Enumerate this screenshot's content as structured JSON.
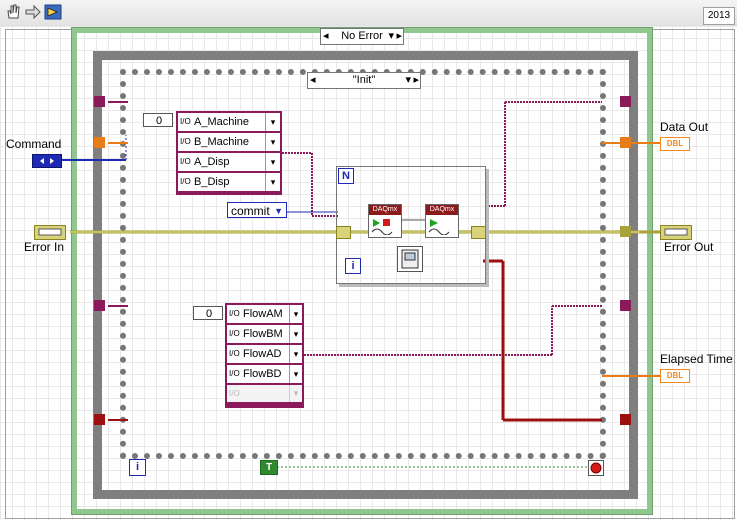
{
  "app": {
    "version": "2013"
  },
  "toolbar": {
    "tools": [
      "hand-tool",
      "arrow-tool",
      "run-icon"
    ]
  },
  "event_case": {
    "selector": "No Error"
  },
  "state_case": {
    "selector": "\"Init\""
  },
  "labels": {
    "command": "Command",
    "error_in": "Error In",
    "data_out": "Data Out",
    "error_out": "Error Out",
    "elapsed_time": "Elapsed Time"
  },
  "ring_a": {
    "index": "0",
    "items": [
      "A_Machine",
      "B_Machine",
      "A_Disp",
      "B_Disp"
    ]
  },
  "ring_b": {
    "index": "0",
    "items": [
      "FlowAM",
      "FlowBM",
      "FlowAD",
      "FlowBD",
      ""
    ]
  },
  "commit_enum": {
    "value": "commit"
  },
  "for_loop": {
    "count_terminal": "N",
    "iteration_terminal": "i"
  },
  "while_loop": {
    "iteration_terminal": "i",
    "true_constant": "T"
  },
  "daqmx": {
    "node1": "DAQmx",
    "node2": "DAQmx"
  },
  "indicators": {
    "dbl": "DBL"
  },
  "colors": {
    "case_green": "#8fc78f",
    "while_gray": "#808080",
    "cluster_wire": "#8b1a5a",
    "error_wire": "#a8a23a",
    "enum_wire": "#1e2ab4",
    "orange_wire": "#e87d18",
    "dbl_wire": "#f08a1c",
    "red_wire": "#9c1010"
  }
}
